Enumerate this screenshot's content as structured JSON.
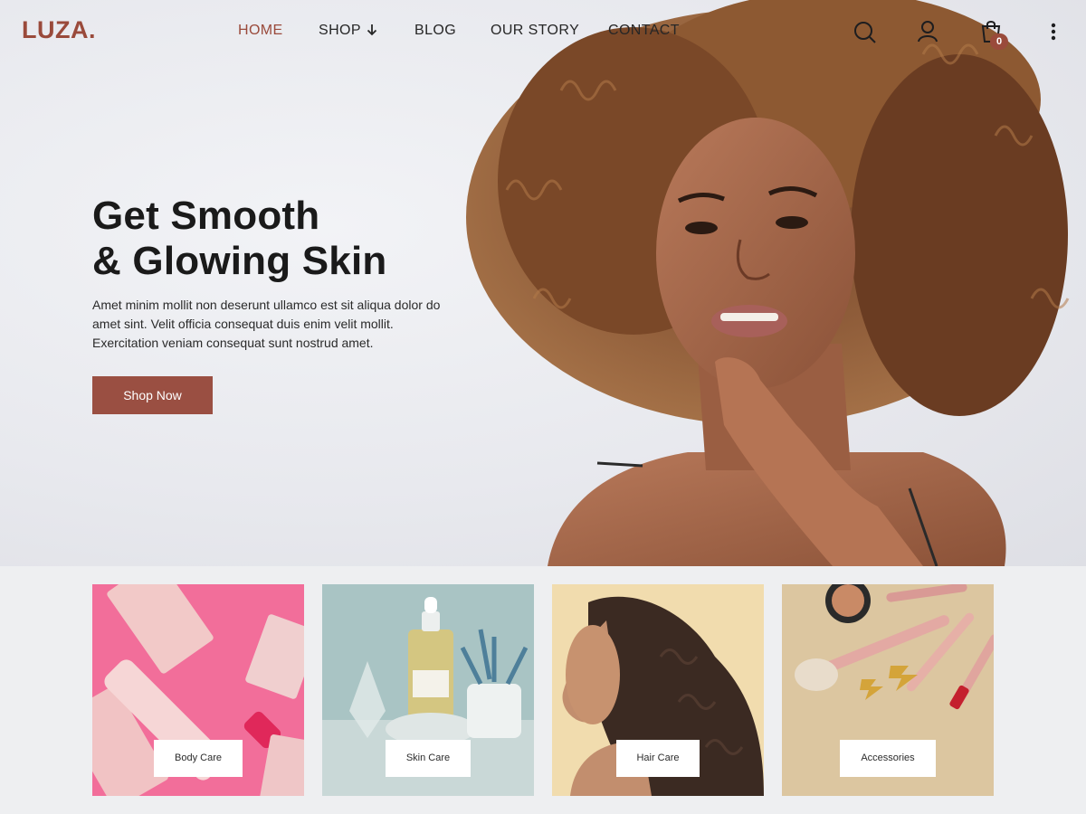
{
  "header": {
    "logo": "LUZA.",
    "nav": [
      {
        "label": "HOME",
        "active": true
      },
      {
        "label": "SHOP",
        "has_dropdown": true
      },
      {
        "label": "BLOG"
      },
      {
        "label": "OUR STORY"
      },
      {
        "label": "CONTACT"
      }
    ],
    "icons": [
      "search-icon",
      "user-icon",
      "cart-icon",
      "more-vertical-icon"
    ],
    "cart_count": "0"
  },
  "hero": {
    "title_line1": "Get Smooth",
    "title_line2": "& Glowing Skin",
    "text": "Amet minim mollit non deserunt ullamco est sit aliqua dolor do amet sint. Velit officia consequat duis enim velit mollit. Exercitation veniam consequat sunt nostrud amet.",
    "cta": "Shop Now"
  },
  "categories": [
    {
      "label": "Body Care"
    },
    {
      "label": "Skin Care"
    },
    {
      "label": "Hair Care"
    },
    {
      "label": "Accessories"
    }
  ],
  "colors": {
    "accent": "#9a4a3b",
    "button": "#9a4f42",
    "page_bg": "#eeeff1"
  }
}
